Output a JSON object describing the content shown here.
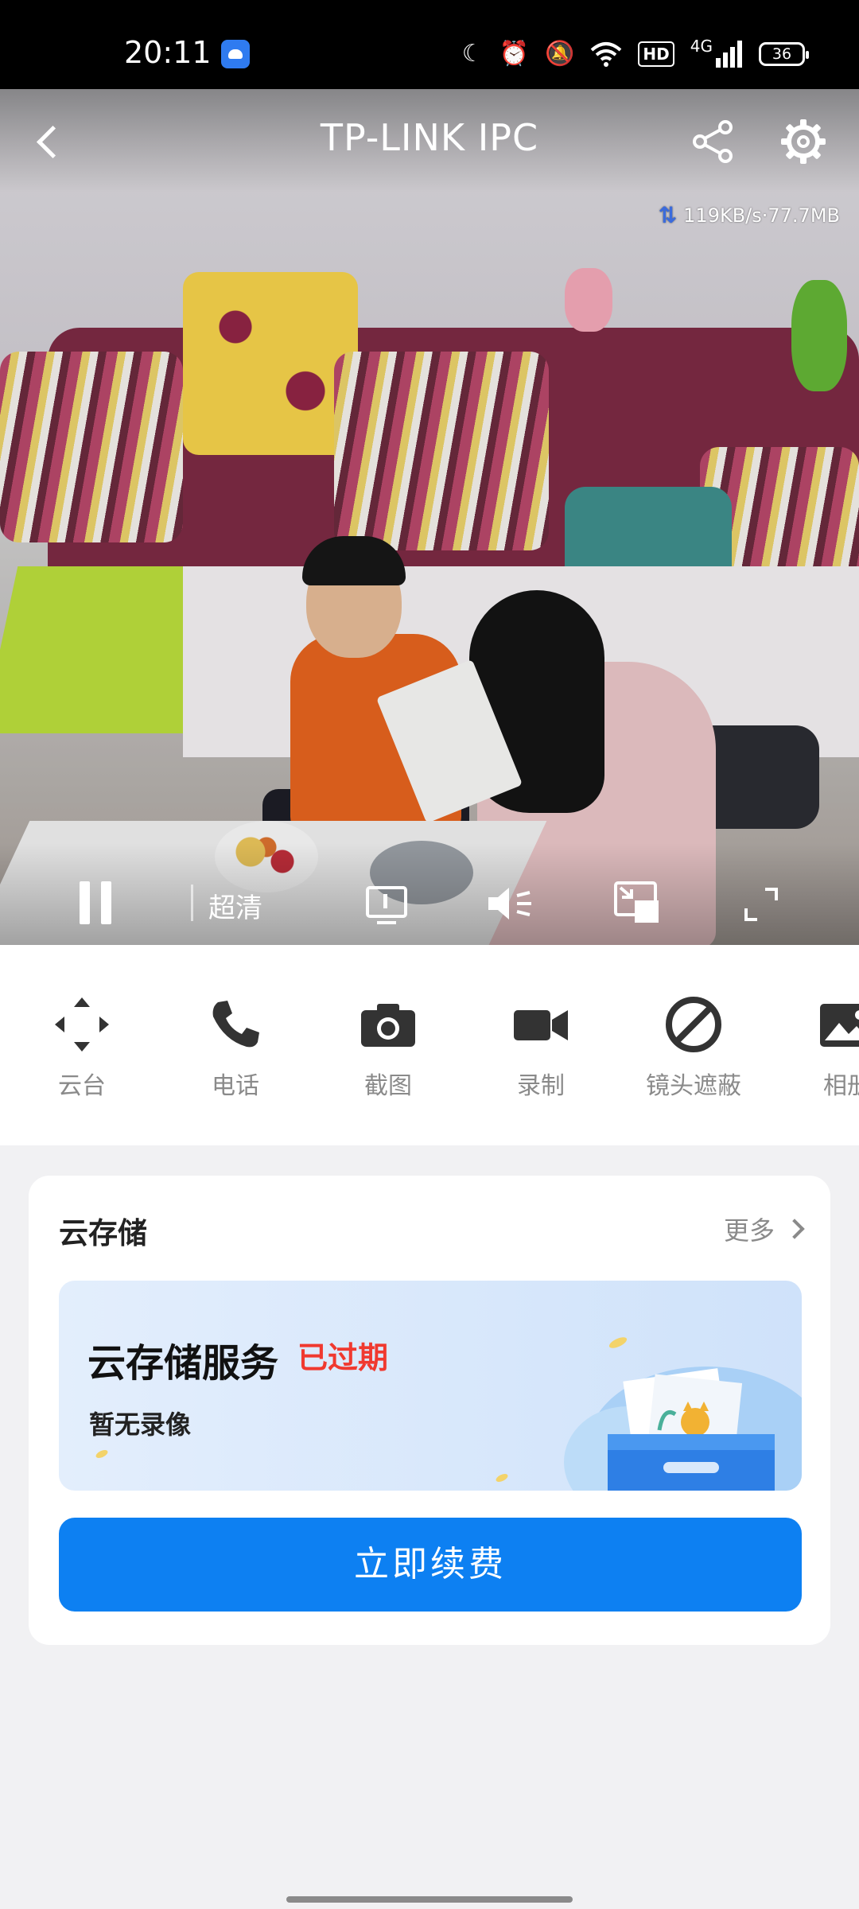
{
  "status_bar": {
    "time": "20:11",
    "icons": [
      "moon-icon",
      "alarm-icon",
      "mute-icon",
      "wifi-icon",
      "hd-icon",
      "signal-icon"
    ],
    "hd_label": "HD",
    "network_label": "4G",
    "battery": "36"
  },
  "video": {
    "title": "TP-LINK IPC",
    "speed": "119KB/s·77.7MB",
    "quality": "超清"
  },
  "toolbar": {
    "items": [
      {
        "label": "云台",
        "icon": "ptz-arrows-icon"
      },
      {
        "label": "电话",
        "icon": "phone-icon"
      },
      {
        "label": "截图",
        "icon": "camera-icon"
      },
      {
        "label": "录制",
        "icon": "video-camera-icon"
      },
      {
        "label": "镜头遮蔽",
        "icon": "lens-block-icon"
      },
      {
        "label": "相册",
        "icon": "album-icon"
      }
    ]
  },
  "cloud_card": {
    "title": "云存储",
    "more": "更多",
    "banner_title": "云存储服务",
    "banner_status": "已过期",
    "banner_sub": "暂无录像",
    "renew_button": "立即续费"
  },
  "colors": {
    "accent": "#0d80f2",
    "expired": "#f0392f",
    "muted_text": "#8a8a8a"
  }
}
